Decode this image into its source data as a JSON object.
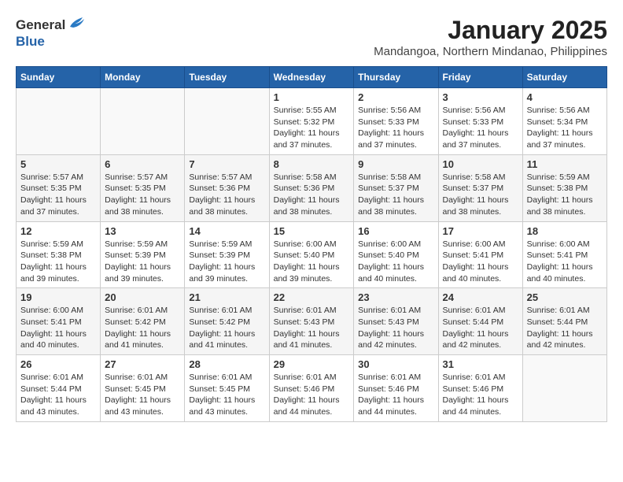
{
  "header": {
    "logo_general": "General",
    "logo_blue": "Blue",
    "month": "January 2025",
    "location": "Mandangoa, Northern Mindanao, Philippines"
  },
  "weekdays": [
    "Sunday",
    "Monday",
    "Tuesday",
    "Wednesday",
    "Thursday",
    "Friday",
    "Saturday"
  ],
  "weeks": [
    [
      {
        "num": "",
        "sunrise": "",
        "sunset": "",
        "daylight": ""
      },
      {
        "num": "",
        "sunrise": "",
        "sunset": "",
        "daylight": ""
      },
      {
        "num": "",
        "sunrise": "",
        "sunset": "",
        "daylight": ""
      },
      {
        "num": "1",
        "sunrise": "5:55 AM",
        "sunset": "5:32 PM",
        "daylight": "11 hours and 37 minutes."
      },
      {
        "num": "2",
        "sunrise": "5:56 AM",
        "sunset": "5:33 PM",
        "daylight": "11 hours and 37 minutes."
      },
      {
        "num": "3",
        "sunrise": "5:56 AM",
        "sunset": "5:33 PM",
        "daylight": "11 hours and 37 minutes."
      },
      {
        "num": "4",
        "sunrise": "5:56 AM",
        "sunset": "5:34 PM",
        "daylight": "11 hours and 37 minutes."
      }
    ],
    [
      {
        "num": "5",
        "sunrise": "5:57 AM",
        "sunset": "5:35 PM",
        "daylight": "11 hours and 37 minutes."
      },
      {
        "num": "6",
        "sunrise": "5:57 AM",
        "sunset": "5:35 PM",
        "daylight": "11 hours and 38 minutes."
      },
      {
        "num": "7",
        "sunrise": "5:57 AM",
        "sunset": "5:36 PM",
        "daylight": "11 hours and 38 minutes."
      },
      {
        "num": "8",
        "sunrise": "5:58 AM",
        "sunset": "5:36 PM",
        "daylight": "11 hours and 38 minutes."
      },
      {
        "num": "9",
        "sunrise": "5:58 AM",
        "sunset": "5:37 PM",
        "daylight": "11 hours and 38 minutes."
      },
      {
        "num": "10",
        "sunrise": "5:58 AM",
        "sunset": "5:37 PM",
        "daylight": "11 hours and 38 minutes."
      },
      {
        "num": "11",
        "sunrise": "5:59 AM",
        "sunset": "5:38 PM",
        "daylight": "11 hours and 38 minutes."
      }
    ],
    [
      {
        "num": "12",
        "sunrise": "5:59 AM",
        "sunset": "5:38 PM",
        "daylight": "11 hours and 39 minutes."
      },
      {
        "num": "13",
        "sunrise": "5:59 AM",
        "sunset": "5:39 PM",
        "daylight": "11 hours and 39 minutes."
      },
      {
        "num": "14",
        "sunrise": "5:59 AM",
        "sunset": "5:39 PM",
        "daylight": "11 hours and 39 minutes."
      },
      {
        "num": "15",
        "sunrise": "6:00 AM",
        "sunset": "5:40 PM",
        "daylight": "11 hours and 39 minutes."
      },
      {
        "num": "16",
        "sunrise": "6:00 AM",
        "sunset": "5:40 PM",
        "daylight": "11 hours and 40 minutes."
      },
      {
        "num": "17",
        "sunrise": "6:00 AM",
        "sunset": "5:41 PM",
        "daylight": "11 hours and 40 minutes."
      },
      {
        "num": "18",
        "sunrise": "6:00 AM",
        "sunset": "5:41 PM",
        "daylight": "11 hours and 40 minutes."
      }
    ],
    [
      {
        "num": "19",
        "sunrise": "6:00 AM",
        "sunset": "5:41 PM",
        "daylight": "11 hours and 40 minutes."
      },
      {
        "num": "20",
        "sunrise": "6:01 AM",
        "sunset": "5:42 PM",
        "daylight": "11 hours and 41 minutes."
      },
      {
        "num": "21",
        "sunrise": "6:01 AM",
        "sunset": "5:42 PM",
        "daylight": "11 hours and 41 minutes."
      },
      {
        "num": "22",
        "sunrise": "6:01 AM",
        "sunset": "5:43 PM",
        "daylight": "11 hours and 41 minutes."
      },
      {
        "num": "23",
        "sunrise": "6:01 AM",
        "sunset": "5:43 PM",
        "daylight": "11 hours and 42 minutes."
      },
      {
        "num": "24",
        "sunrise": "6:01 AM",
        "sunset": "5:44 PM",
        "daylight": "11 hours and 42 minutes."
      },
      {
        "num": "25",
        "sunrise": "6:01 AM",
        "sunset": "5:44 PM",
        "daylight": "11 hours and 42 minutes."
      }
    ],
    [
      {
        "num": "26",
        "sunrise": "6:01 AM",
        "sunset": "5:44 PM",
        "daylight": "11 hours and 43 minutes."
      },
      {
        "num": "27",
        "sunrise": "6:01 AM",
        "sunset": "5:45 PM",
        "daylight": "11 hours and 43 minutes."
      },
      {
        "num": "28",
        "sunrise": "6:01 AM",
        "sunset": "5:45 PM",
        "daylight": "11 hours and 43 minutes."
      },
      {
        "num": "29",
        "sunrise": "6:01 AM",
        "sunset": "5:46 PM",
        "daylight": "11 hours and 44 minutes."
      },
      {
        "num": "30",
        "sunrise": "6:01 AM",
        "sunset": "5:46 PM",
        "daylight": "11 hours and 44 minutes."
      },
      {
        "num": "31",
        "sunrise": "6:01 AM",
        "sunset": "5:46 PM",
        "daylight": "11 hours and 44 minutes."
      },
      {
        "num": "",
        "sunrise": "",
        "sunset": "",
        "daylight": ""
      }
    ]
  ],
  "labels": {
    "sunrise": "Sunrise:",
    "sunset": "Sunset:",
    "daylight": "Daylight:"
  }
}
